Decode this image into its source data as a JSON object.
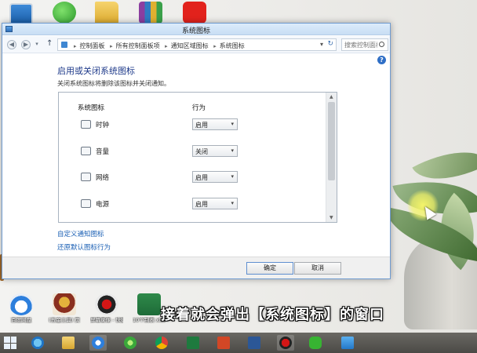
{
  "window": {
    "title": "系统图标",
    "breadcrumb": [
      "控制面板",
      "所有控制面板项",
      "通知区域图标",
      "系统图标"
    ],
    "search_placeholder": "搜索控制面板",
    "heading": "启用或关闭系统图标",
    "description": "关闭系统图标将删除该图标并关闭通知。",
    "columns": {
      "icon": "系统图标",
      "behavior": "行为"
    },
    "rows": [
      {
        "label": "时钟",
        "value": "启用",
        "icon": "clock-icon"
      },
      {
        "label": "音量",
        "value": "关闭",
        "icon": "volume-icon"
      },
      {
        "label": "网络",
        "value": "启用",
        "icon": "network-icon"
      },
      {
        "label": "电源",
        "value": "启用",
        "icon": "power-icon"
      }
    ],
    "links": {
      "customize": "自定义通知图标",
      "restore": "还原默认图标行为"
    },
    "buttons": {
      "ok": "确定",
      "cancel": "取消"
    }
  },
  "desktop": {
    "bottom_icons": [
      {
        "label": "百度网盘",
        "icon": "baidu-netdisk-icon"
      },
      {
        "label": "(五金工具)\n页",
        "icon": "hawk-icon"
      },
      {
        "label": "屏幕录像 - 快捷方式",
        "icon": "screen-recorder-icon"
      },
      {
        "label": "10个制表\nxlsx",
        "icon": "excel-file-icon"
      }
    ]
  },
  "subtitle": "接着就会弹出【系统图标】的窗口",
  "taskbar": {
    "items": [
      "ie-icon",
      "explorer-icon",
      "baidu-netdisk-icon",
      "360-browser-icon",
      "chrome-icon",
      "excel-icon",
      "powerpoint-icon",
      "word-icon",
      "recorder-icon",
      "wechat-icon",
      "remote-desktop-icon"
    ]
  },
  "colors": {
    "accent": "#1e3a8a",
    "link": "#1a5fb4",
    "window_border": "#6f9bd0",
    "taskbar": "#4b4a46"
  }
}
